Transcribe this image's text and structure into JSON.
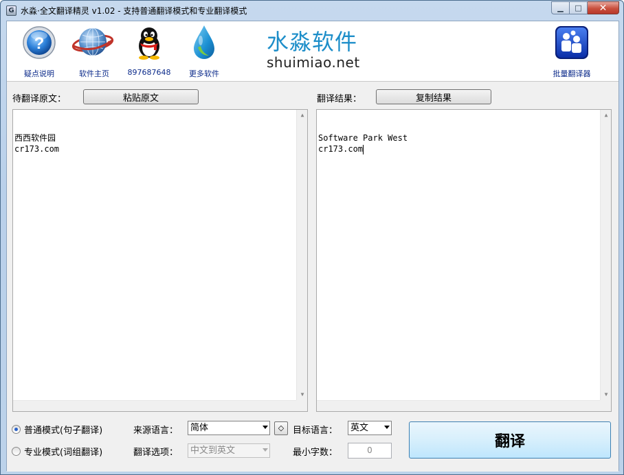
{
  "window": {
    "title": "水淼·全文翻译精灵 v1.02 - 支持普通翻译模式和专业翻译模式",
    "icon_letter": "G",
    "minimize_glyph": "▁",
    "maximize_glyph": "□",
    "close_glyph": "✕"
  },
  "toolbar": {
    "items": [
      {
        "label": "疑点说明",
        "icon": "help-icon"
      },
      {
        "label": "软件主页",
        "icon": "globe-icon"
      },
      {
        "label": "897687648",
        "icon": "qq-penguin-icon"
      },
      {
        "label": "更多软件",
        "icon": "water-drop-icon"
      }
    ],
    "brand_cn": "水淼软件",
    "brand_en": "shuimiao.net",
    "batch": {
      "label": "批量翻译器",
      "icon": "batch-translator-icon"
    }
  },
  "source": {
    "label": "待翻译原文：",
    "paste_button": "粘贴原文",
    "text": "西西软件园\ncr173.com"
  },
  "result": {
    "label": "翻译结果：",
    "copy_button": "复制结果",
    "text": "Software Park West\ncr173.com"
  },
  "options": {
    "mode_normal": "普通模式(句子翻译)",
    "mode_pro": "专业模式(词组翻译)",
    "mode_selected": "normal",
    "source_lang_label": "来源语言：",
    "source_lang_value": "简体",
    "swap_glyph": "◇",
    "target_lang_label": "目标语言：",
    "target_lang_value": "英文",
    "translate_option_label": "翻译选项：",
    "translate_option_value": "中文到英文",
    "min_chars_label": "最小字数：",
    "min_chars_value": "0",
    "translate_button": "翻译"
  },
  "colors": {
    "brand_blue": "#1d8ec9",
    "link_blue": "#0b2a8a",
    "radio_dot": "#2a62c9"
  }
}
